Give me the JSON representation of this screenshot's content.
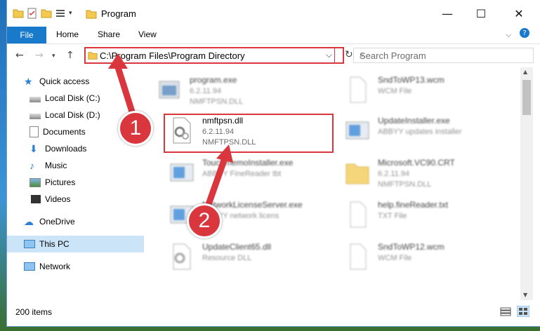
{
  "window": {
    "title": "Program",
    "minimize": "—",
    "maximize": "☐",
    "close": "✕"
  },
  "ribbon": {
    "file": "File",
    "tabs": [
      "Home",
      "Share",
      "View"
    ]
  },
  "address": {
    "path": "C:\\Program Files\\Program Directory",
    "search_placeholder": "Search Program"
  },
  "nav": {
    "items": [
      {
        "label": "Quick access"
      },
      {
        "label": "Local Disk (C:)"
      },
      {
        "label": "Local Disk (D:)"
      },
      {
        "label": "Documents"
      },
      {
        "label": "Downloads"
      },
      {
        "label": "Music"
      },
      {
        "label": "Pictures"
      },
      {
        "label": "Videos"
      },
      {
        "label": "OneDrive"
      },
      {
        "label": "This PC"
      },
      {
        "label": "Network"
      }
    ]
  },
  "files": [
    {
      "name": "program.exe",
      "line1": "6.2.11.94",
      "line2": "NMFTPSN.DLL"
    },
    {
      "name": "SndToWP13.wcm",
      "line1": "WCM File",
      "line2": ""
    },
    {
      "name": "nmftpsn.dll",
      "line1": "6.2.11.94",
      "line2": "NMFTPSN.DLL"
    },
    {
      "name": "UpdateInstaller.exe",
      "line1": "ABBYY updates installer",
      "line2": ""
    },
    {
      "name": "TouchmemoInstaller.exe",
      "line1": "ABBYY FineReader tbt",
      "line2": ""
    },
    {
      "name": "Microsoft.VC90.CRT",
      "line1": "6.2.11.94",
      "line2": "NMFTPSN.DLL"
    },
    {
      "name": "NetworkLicenseServer.exe",
      "line1": "ABBYY network licens",
      "line2": ""
    },
    {
      "name": "help.fineReader.txt",
      "line1": "TXT File",
      "line2": ""
    },
    {
      "name": "UpdateClient65.dll",
      "line1": "Resource DLL",
      "line2": ""
    },
    {
      "name": "SndToWP12.wcm",
      "line1": "WCM File",
      "line2": ""
    }
  ],
  "status": {
    "count": "200 items"
  },
  "annotations": {
    "step1": "1",
    "step2": "2"
  },
  "colors": {
    "accent": "#1979ca",
    "highlight": "#d9363e"
  }
}
